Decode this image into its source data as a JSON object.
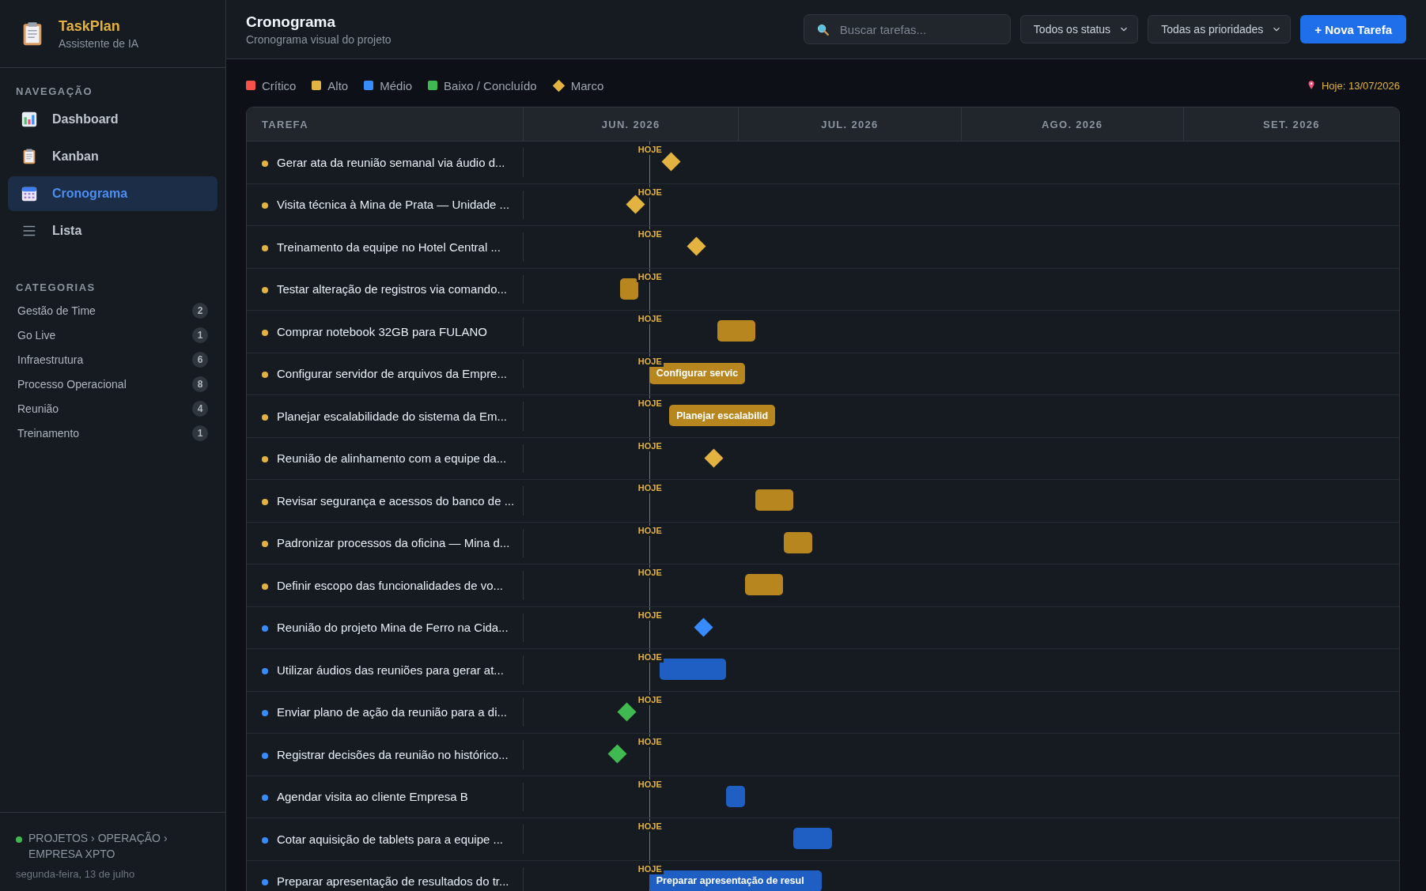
{
  "sidebar": {
    "app_name": "TaskPlan",
    "app_subtitle": "Assistente de IA",
    "nav_heading": "NAVEGAÇÃO",
    "nav_items": [
      {
        "label": "Dashboard",
        "selected": false
      },
      {
        "label": "Kanban",
        "selected": false
      },
      {
        "label": "Cronograma",
        "selected": true
      },
      {
        "label": "Lista",
        "selected": false
      }
    ],
    "categories_heading": "CATEGORIAS",
    "categories": [
      {
        "name": "Gestão de Time",
        "count": "2"
      },
      {
        "name": "Go Live",
        "count": "1"
      },
      {
        "name": "Infraestrutura",
        "count": "6"
      },
      {
        "name": "Processo Operacional",
        "count": "8"
      },
      {
        "name": "Reunião",
        "count": "4"
      },
      {
        "name": "Treinamento",
        "count": "1"
      }
    ],
    "footer": {
      "breadcrumb": "PROJETOS › OPERAÇÃO › EMPRESA XPTO",
      "date": "segunda-feira, 13 de julho"
    }
  },
  "header": {
    "title": "Cronograma",
    "subtitle": "Cronograma visual do projeto",
    "search": {
      "placeholder": "Buscar tarefas..."
    },
    "status_filter": "Todos os status",
    "priority_filter": "Todas as prioridades",
    "new_task_button": "+ Nova Tarefa"
  },
  "legend": [
    {
      "kind": "square",
      "label": "Crítico",
      "color": "#f85149"
    },
    {
      "kind": "square",
      "label": "Alto",
      "color": "#e3b341"
    },
    {
      "kind": "square",
      "label": "Médio",
      "color": "#388bfd"
    },
    {
      "kind": "square",
      "label": "Baixo / Concluído",
      "color": "#3fb950"
    },
    {
      "kind": "diamond",
      "label": "Marco",
      "color": "#e3b341"
    }
  ],
  "today_note": "Hoje: 13/07/2026",
  "gantt": {
    "task_column": "TAREFA",
    "months": [
      "JUN. 2026",
      "JUL. 2026",
      "AGO. 2026",
      "SET. 2026"
    ],
    "tasks": [
      {
        "name": "Gerar ata da reunião semanal via áudio d...",
        "color": "#e3b341",
        "today_tag": "HOJE",
        "bar": {
          "kind": "milestone",
          "color": "#e3b341"
        }
      },
      {
        "name": "Visita técnica à Mina de Prata — Unidade ...",
        "color": "#e3b341",
        "today_tag": "HOJE",
        "bar": {
          "kind": "milestone",
          "color": "#e3b341"
        }
      },
      {
        "name": "Treinamento da equipe no Hotel Central ...",
        "color": "#e3b341",
        "today_tag": "HOJE",
        "bar": {
          "kind": "milestone",
          "color": "#e3b341"
        }
      },
      {
        "name": "Testar alteração de registros via comando...",
        "color": "#e3b341",
        "today_tag": "HOJE",
        "bar": {
          "kind": "task",
          "color": "#b7861f"
        }
      },
      {
        "name": "Comprar notebook 32GB para FULANO",
        "color": "#e3b341",
        "today_tag": "HOJE",
        "bar": {
          "kind": "task",
          "color": "#b7861f"
        }
      },
      {
        "name": "Configurar servidor de arquivos da Empre...",
        "color": "#e3b341",
        "today_tag": "HOJE",
        "bar": {
          "kind": "task",
          "color": "#b7861f",
          "label": "Configurar servic"
        }
      },
      {
        "name": "Planejar escalabilidade do sistema da Em...",
        "color": "#e3b341",
        "today_tag": "HOJE",
        "bar": {
          "kind": "task",
          "color": "#b7861f",
          "label": "Planejar escalabilid"
        }
      },
      {
        "name": "Reunião de alinhamento com a equipe da...",
        "color": "#e3b341",
        "today_tag": "HOJE",
        "bar": {
          "kind": "milestone",
          "color": "#e3b341"
        }
      },
      {
        "name": "Revisar segurança e acessos do banco de ...",
        "color": "#e3b341",
        "today_tag": "HOJE",
        "bar": {
          "kind": "task",
          "color": "#b7861f"
        }
      },
      {
        "name": "Padronizar processos da oficina — Mina d...",
        "color": "#e3b341",
        "today_tag": "HOJE",
        "bar": {
          "kind": "task",
          "color": "#b7861f"
        }
      },
      {
        "name": "Definir escopo das funcionalidades de vo...",
        "color": "#e3b341",
        "today_tag": "HOJE",
        "bar": {
          "kind": "task",
          "color": "#b7861f"
        }
      },
      {
        "name": "Reunião do projeto Mina de Ferro na Cida...",
        "color": "#388bfd",
        "today_tag": "HOJE",
        "bar": {
          "kind": "milestone",
          "color": "#388bfd"
        }
      },
      {
        "name": "Utilizar áudios das reuniões para gerar at...",
        "color": "#388bfd",
        "today_tag": "HOJE",
        "bar": {
          "kind": "task",
          "color": "#1f5fc4"
        }
      },
      {
        "name": "Enviar plano de ação da reunião para a di...",
        "color": "#388bfd",
        "today_tag": "HOJE",
        "bar": {
          "kind": "milestone",
          "color": "#3fb950"
        }
      },
      {
        "name": "Registrar decisões da reunião no histórico...",
        "color": "#388bfd",
        "today_tag": "HOJE",
        "bar": {
          "kind": "milestone",
          "color": "#3fb950"
        }
      },
      {
        "name": "Agendar visita ao cliente Empresa B",
        "color": "#388bfd",
        "today_tag": "HOJE",
        "bar": {
          "kind": "task",
          "color": "#1f5fc4"
        }
      },
      {
        "name": "Cotar aquisição de tablets para a equipe ...",
        "color": "#388bfd",
        "today_tag": "HOJE",
        "bar": {
          "kind": "task",
          "color": "#1f5fc4"
        }
      },
      {
        "name": "Preparar apresentação de resultados do tr...",
        "color": "#388bfd",
        "today_tag": "HOJE",
        "bar": {
          "kind": "task",
          "color": "#1f5fc4",
          "label": "Preparar apresentação de resul"
        }
      }
    ]
  }
}
